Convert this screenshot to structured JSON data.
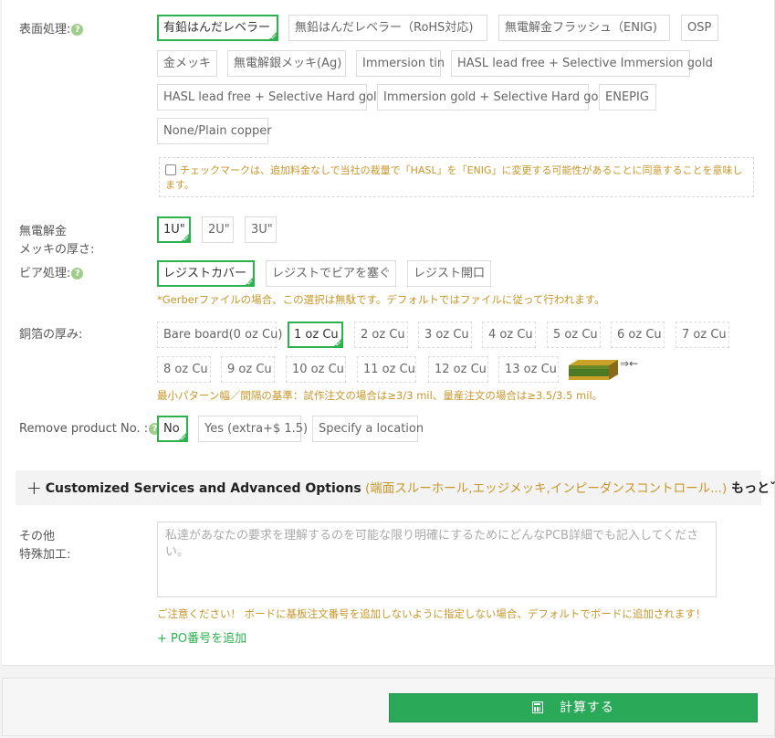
{
  "surface": {
    "label": "表面処理:",
    "options": [
      "有鉛はんだレベラー",
      "無鉛はんだレベラー（RoHS対応)",
      "無電解金フラッシュ（ENIG)",
      "OSP",
      "金メッキ",
      "無電解銀メッキ(Ag)",
      "Immersion tin",
      "HASL lead free + Selective Immersion gold",
      "HASL lead free + Selective Hard gold",
      "Immersion gold + Selective Hard gold",
      "ENEPIG",
      "None/Plain copper"
    ],
    "selected": "有鉛はんだレベラー",
    "confirm_text": "チェックマークは、追加料金なしで当社の裁量で「HASL」を「ENIG」に変更する可能性があることに同意することを意味します。"
  },
  "plating": {
    "label_line1": "無電解金",
    "label_line2": "メッキの厚さ:",
    "options": [
      "1U\"",
      "2U\"",
      "3U\""
    ]
  },
  "via": {
    "label": "ビア処理:",
    "options": [
      "レジストカバー",
      "レジストでビアを塞ぐ",
      "レジスト開口"
    ],
    "note": "*Gerberファイルの場合、この選択は無駄です。デフォルトではファイルに従って行われます。"
  },
  "copper": {
    "label": "銅箔の厚み:",
    "options": [
      "Bare board(0 oz Cu)",
      "1 oz Cu",
      "2 oz Cu",
      "3 oz Cu",
      "4 oz Cu",
      "5 oz Cu",
      "6 oz Cu",
      "7 oz Cu",
      "8 oz Cu",
      "9 oz Cu",
      "10 oz Cu",
      "11 oz Cu",
      "12 oz Cu",
      "13 oz Cu"
    ],
    "arrow": "⇒←",
    "note": "最小パターン幅／間隔の基準：試作注文の場合は≥3/3 mil、量産注文の場合は≥3.5/3.5 mil。"
  },
  "remove": {
    "label": "Remove product No. :",
    "options": [
      "No",
      "Yes (extra+$ 1.5)",
      "Specify a location"
    ]
  },
  "advanced": {
    "plus": "+",
    "title": "Customized Services and Advanced Options",
    "sub": " (端面スルーホール,エッジメッキ,インピーダンスコントロール...)",
    "more": " もっと",
    "chevron": "ˇ"
  },
  "special": {
    "label_line1": "その他",
    "label_line2": "特殊加工:",
    "placeholder": "私達があなたの要求を理解するのを可能な限り明確にするためにどんなPCB詳細でも記入してください。",
    "note": "ご注意ください！ ボードに基板注文番号を追加しないように指定しない場合、デフォルトでボードに追加されます！",
    "po_link": "+ PO番号を追加"
  },
  "help_icon": "?",
  "calc_label": "計算する",
  "colors": {
    "accent": "#2bb24c",
    "warning": "#c8962a",
    "button": "#2aaa59"
  }
}
